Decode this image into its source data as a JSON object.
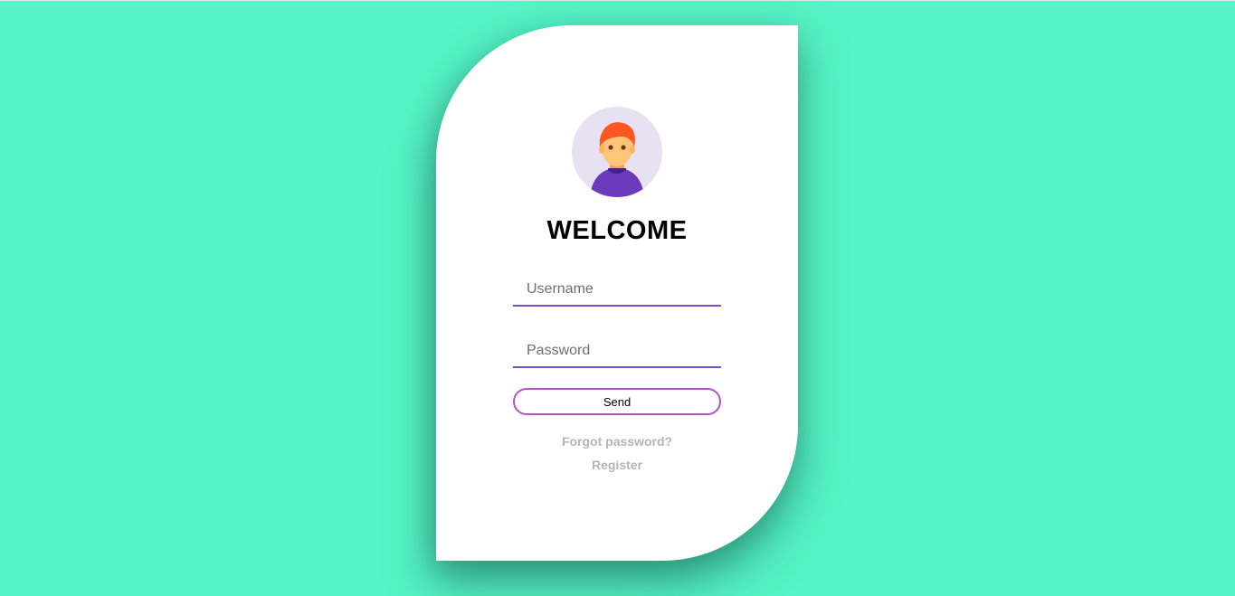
{
  "colors": {
    "background": "#55f3c5",
    "card": "#ffffff",
    "accent_purple": "#7a4fc9",
    "button_border": "#b352c7",
    "link_gray": "#b5b5b5"
  },
  "avatar": {
    "icon": "user-avatar-icon"
  },
  "login": {
    "title": "WELCOME",
    "username_placeholder": "Username",
    "password_placeholder": "Password",
    "send_label": "Send",
    "forgot_label": "Forgot password?",
    "register_label": "Register"
  }
}
